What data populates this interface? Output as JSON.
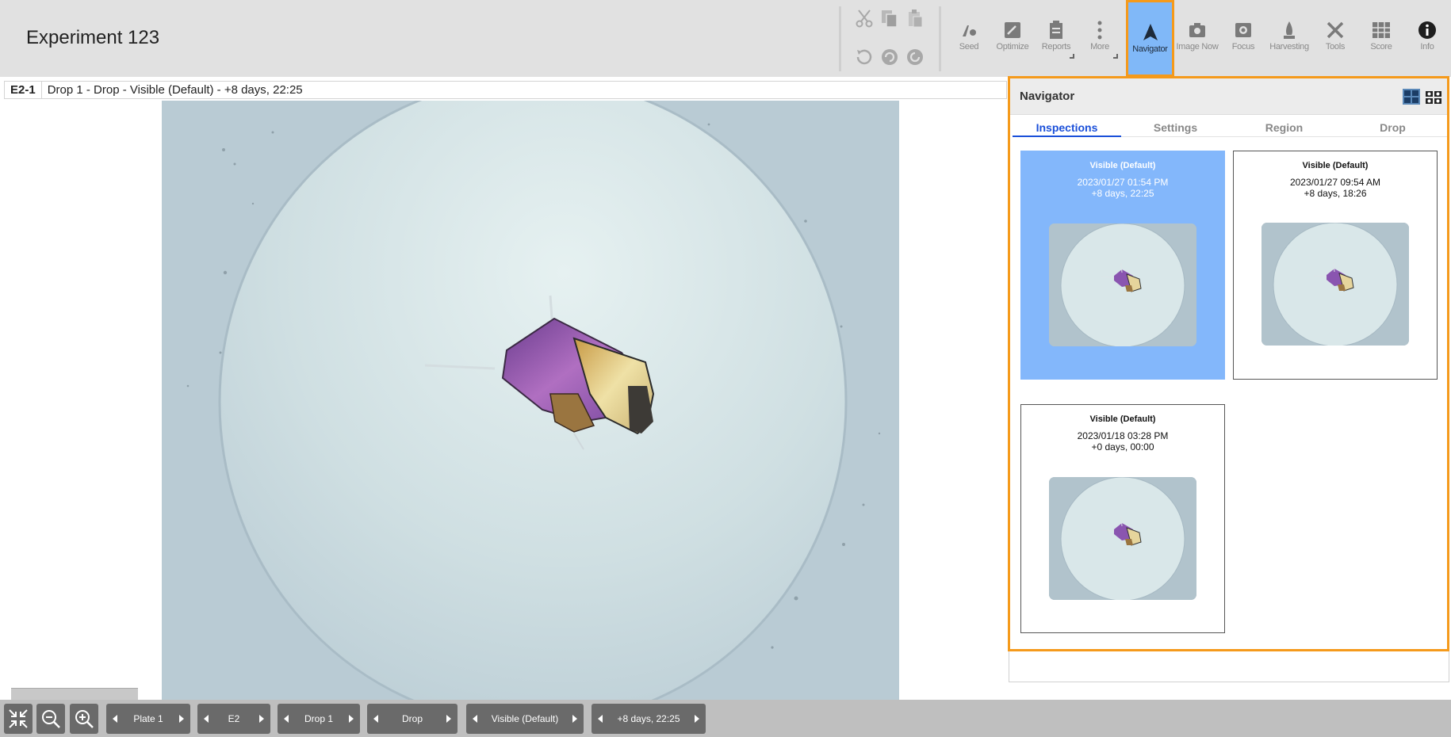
{
  "app": {
    "title": "Experiment 123"
  },
  "toolbar": {
    "edit_icons": [
      "cut-icon",
      "copy-icon",
      "paste-icon",
      "undo-icon",
      "redo-icon",
      "history-icon"
    ],
    "tools": [
      {
        "label": "Seed",
        "icon": "seed-icon"
      },
      {
        "label": "Optimize",
        "icon": "optimize-icon"
      },
      {
        "label": "Reports",
        "icon": "reports-icon"
      },
      {
        "label": "More",
        "icon": "more-icon"
      },
      {
        "label": "Navigator",
        "icon": "navigator-icon",
        "active": true
      },
      {
        "label": "Image Now",
        "icon": "camera-icon"
      },
      {
        "label": "Focus",
        "icon": "focus-icon"
      },
      {
        "label": "Harvesting",
        "icon": "harvesting-icon"
      },
      {
        "label": "Tools",
        "icon": "tools-icon"
      },
      {
        "label": "Score",
        "icon": "score-icon"
      },
      {
        "label": "Info",
        "icon": "info-icon"
      }
    ]
  },
  "caption": {
    "well": "E2-1",
    "description": "Drop 1 - Drop - Visible (Default) - +8 days, 22:25"
  },
  "navigator": {
    "title": "Navigator",
    "tabs": [
      "Inspections",
      "Settings",
      "Region",
      "Drop"
    ],
    "active_tab": "Inspections",
    "inspections": [
      {
        "title": "Visible (Default)",
        "date": "2023/01/27 01:54 PM",
        "elapsed": "+8 days, 22:25",
        "selected": true
      },
      {
        "title": "Visible (Default)",
        "date": "2023/01/27 09:54 AM",
        "elapsed": "+8 days, 18:26",
        "selected": false
      },
      {
        "title": "Visible (Default)",
        "date": "2023/01/18 03:28 PM",
        "elapsed": "+0 days, 00:00",
        "selected": false
      }
    ]
  },
  "bottom_nav": {
    "plate": "Plate 1",
    "well": "E2",
    "drop": "Drop 1",
    "region": "Drop",
    "imaging": "Visible (Default)",
    "time": "+8 days, 22:25"
  },
  "colors": {
    "accent_orange": "#f59a1b",
    "selected_blue": "#83b7fb",
    "tab_blue": "#1a4fd9"
  }
}
